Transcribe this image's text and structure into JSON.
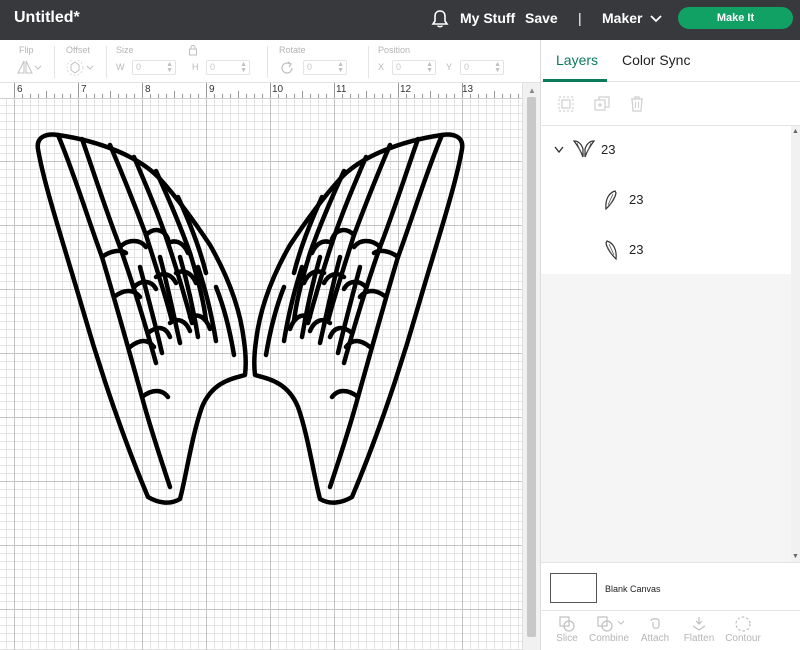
{
  "header": {
    "title": "Untitled*",
    "my_stuff": "My Stuff",
    "save": "Save",
    "separator": "|",
    "machine": "Maker",
    "make_it": "Make It"
  },
  "toolbar": {
    "flip": "Flip",
    "offset": "Offset",
    "size": "Size",
    "size_w_axis": "W",
    "size_h_axis": "H",
    "size_w": "0",
    "size_h": "0",
    "rotate": "Rotate",
    "rotate_value": "0",
    "position": "Position",
    "pos_x_axis": "X",
    "pos_y_axis": "Y",
    "pos_x": "0",
    "pos_y": "0"
  },
  "ruler": {
    "labels": [
      "6",
      "7",
      "8",
      "9",
      "10",
      "11",
      "12",
      "13"
    ]
  },
  "panel": {
    "tabs": [
      {
        "label": "Layers",
        "active": true
      },
      {
        "label": "Color Sync",
        "active": false
      }
    ],
    "layers": [
      {
        "name": "23",
        "icon": "butterfly-icon",
        "level": 0
      },
      {
        "name": "23",
        "icon": "wing-left-icon",
        "level": 1
      },
      {
        "name": "23",
        "icon": "wing-right-icon",
        "level": 1
      }
    ],
    "blank_canvas": "Blank Canvas",
    "tools": [
      "Slice",
      "Combine",
      "Attach",
      "Flatten",
      "Contour"
    ]
  },
  "colors": {
    "header_bg": "#37393d",
    "accent": "#12a164",
    "tab_active": "#0b7a5b"
  }
}
